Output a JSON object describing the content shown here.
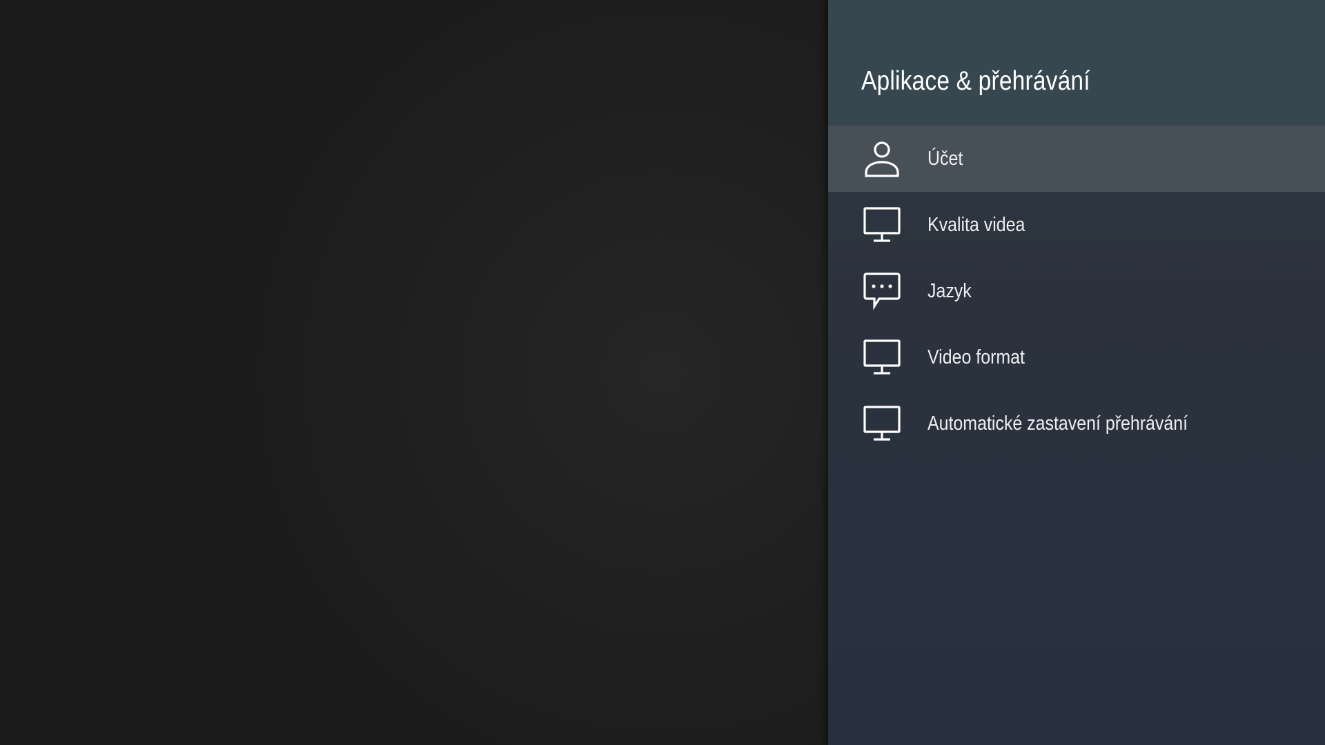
{
  "panel": {
    "title": "Aplikace & přehrávání"
  },
  "menu": {
    "items": [
      {
        "label": "Účet",
        "icon": "account-icon",
        "selected": true
      },
      {
        "label": "Kvalita videa",
        "icon": "monitor-icon",
        "selected": false
      },
      {
        "label": "Jazyk",
        "icon": "chat-bubble-icon",
        "selected": false
      },
      {
        "label": "Video format",
        "icon": "monitor-icon",
        "selected": false
      },
      {
        "label": "Automatické zastavení přehrávání",
        "icon": "monitor-icon",
        "selected": false
      }
    ]
  },
  "colors": {
    "panel_header": "#37474f",
    "selected_item": "#474f57",
    "background": "#1c1c1c"
  }
}
